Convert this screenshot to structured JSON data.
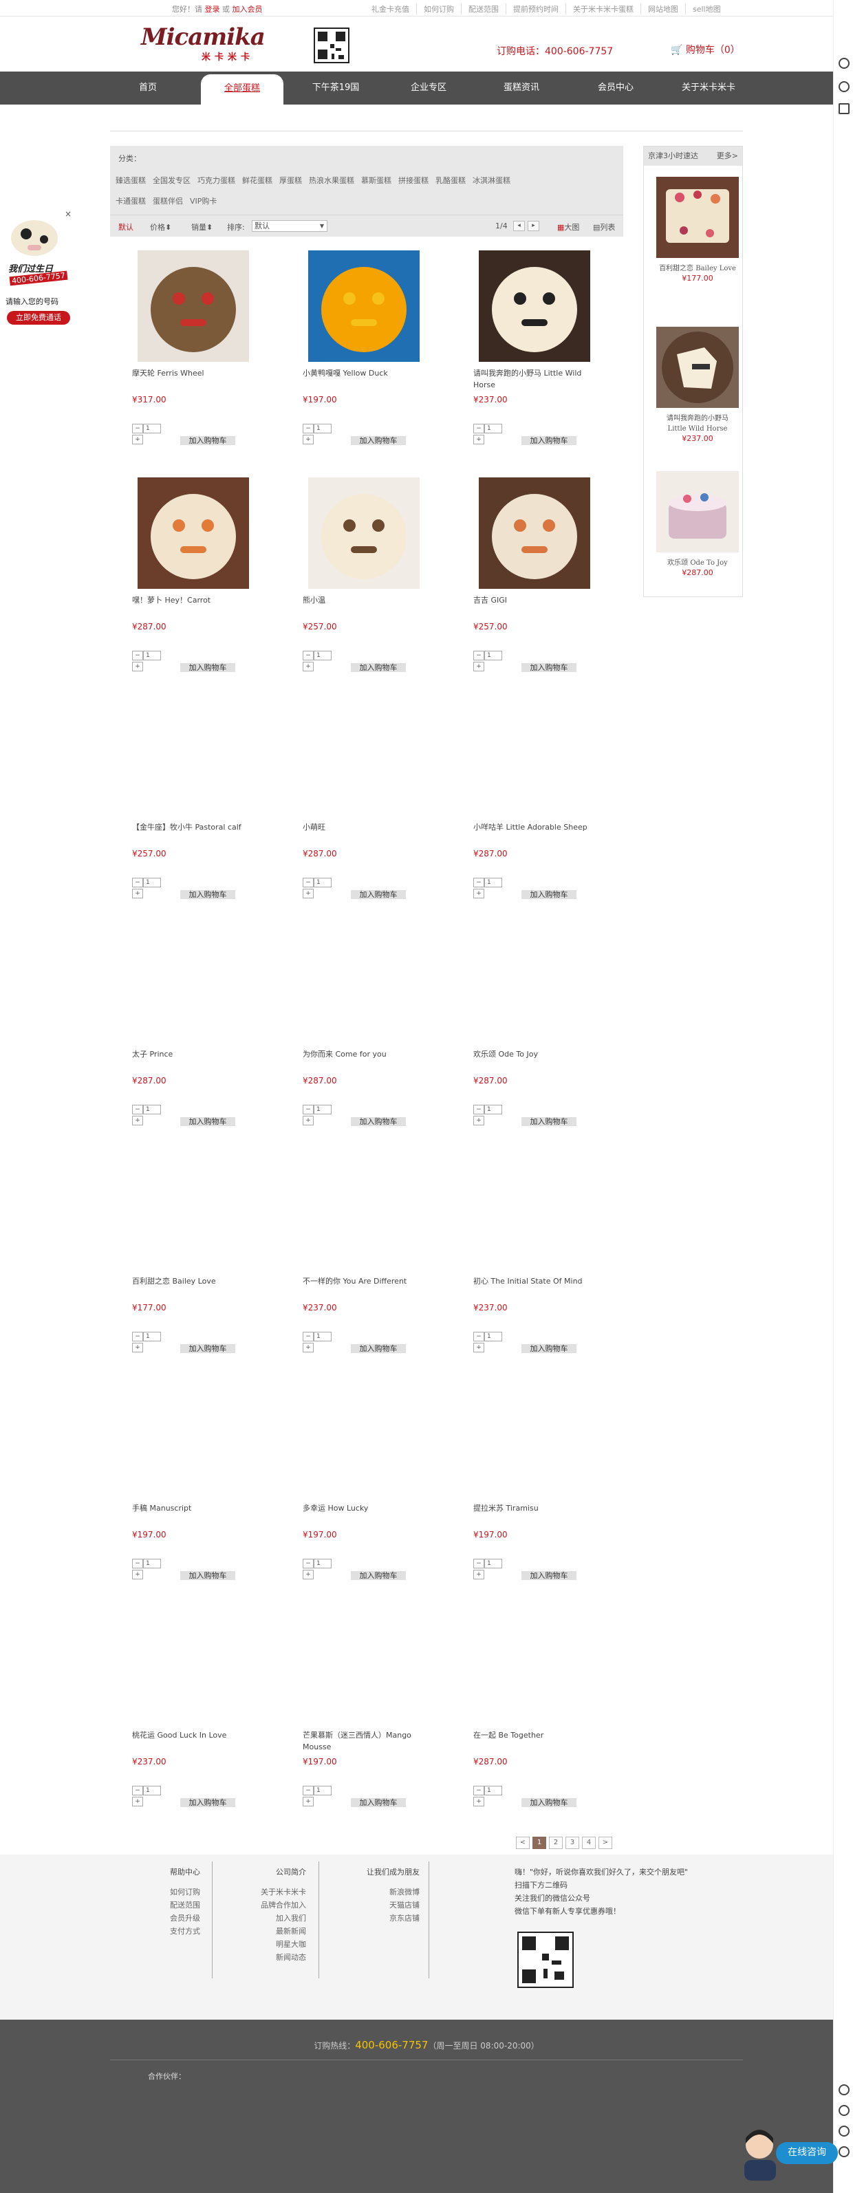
{
  "topbar": {
    "greeting_pre": "您好！请",
    "login": "登录",
    "or": "或",
    "register": "加入会员",
    "links": [
      "礼金卡充值",
      "如何订购",
      "配送范围",
      "提前预约时间",
      "关于米卡米卡蛋糕",
      "网站地图",
      "sell地图"
    ]
  },
  "header": {
    "logo_text": "Micamika",
    "logo_sub": "米卡米卡",
    "phone": "订购电话：400-606-7757",
    "cart": "购物车（0）"
  },
  "nav": [
    "首页",
    "全部蛋糕",
    "下午茶19国",
    "企业专区",
    "蛋糕资讯",
    "会员中心",
    "关于米卡米卡"
  ],
  "filter": {
    "label": "分类：",
    "categories": [
      "臻选蛋糕",
      "全国发专区",
      "巧克力蛋糕",
      "鲜花蛋糕",
      "厚蛋糕",
      "热浪水果蛋糕",
      "慕斯蛋糕",
      "拼接蛋糕",
      "乳酪蛋糕",
      "冰淇淋蛋糕",
      "卡通蛋糕",
      "蛋糕伴侣",
      "VIP购卡"
    ]
  },
  "sort": {
    "default": "默认",
    "price": "价格",
    "sales": "销量",
    "sort_label": "排序:",
    "sort_value": "默认",
    "page": "1/4",
    "view_big": "大图",
    "view_list": "列表"
  },
  "products": [
    {
      "name": "摩天轮 Ferris Wheel",
      "price": "¥317.00"
    },
    {
      "name": "小黄鸭嘎嘎 Yellow Duck",
      "price": "¥197.00"
    },
    {
      "name": "请叫我奔跑的小野马 Little Wild Horse",
      "price": "¥237.00"
    },
    {
      "name": "嘿！萝卜 Hey！Carrot",
      "price": "¥287.00"
    },
    {
      "name": "熊小温",
      "price": "¥257.00"
    },
    {
      "name": "吉吉 GIGI",
      "price": "¥257.00"
    },
    {
      "name": "【金牛座】牧小牛 Pastoral calf",
      "price": "¥257.00"
    },
    {
      "name": "小萌旺",
      "price": "¥287.00"
    },
    {
      "name": "小咩咕羊 Little Adorable Sheep",
      "price": "¥287.00"
    },
    {
      "name": "太子 Prince",
      "price": "¥287.00"
    },
    {
      "name": "为你而来 Come for you",
      "price": "¥287.00"
    },
    {
      "name": "欢乐颂 Ode To Joy",
      "price": "¥287.00"
    },
    {
      "name": "百利甜之恋 Bailey Love",
      "price": "¥177.00"
    },
    {
      "name": "不一样的你 You Are Different",
      "price": "¥237.00"
    },
    {
      "name": "初心 The Initial State Of Mind",
      "price": "¥237.00"
    },
    {
      "name": "手稿 Manuscript",
      "price": "¥197.00"
    },
    {
      "name": "多幸运 How Lucky",
      "price": "¥197.00"
    },
    {
      "name": "提拉米苏 Tiramisu",
      "price": "¥197.00"
    },
    {
      "name": "桃花运 Good Luck In Love",
      "price": "¥237.00"
    },
    {
      "name": "芒果慕斯（迷三西情人）Mango Mousse",
      "price": "¥197.00"
    },
    {
      "name": "在一起 Be Together",
      "price": "¥287.00"
    }
  ],
  "qty_default": "1",
  "add_to_cart": "加入购物车",
  "sidebar": {
    "title": "京津3小时速达",
    "more": "更多>",
    "items": [
      {
        "name": "百利甜之恋 Bailey Love",
        "price": "¥177.00"
      },
      {
        "name": "请叫我奔跑的小野马 Little Wild Horse",
        "price": "¥237.00"
      },
      {
        "name": "欢乐颂 Ode To Joy",
        "price": "¥287.00"
      }
    ]
  },
  "float_ad": {
    "line1": "我们过生日",
    "phone": "400-606-7757",
    "line2": "请输入您的号码",
    "btn": "立即免费通话"
  },
  "pager": [
    "<",
    "1",
    "2",
    "3",
    "4",
    ">"
  ],
  "footer": {
    "col1": {
      "title": "帮助中心",
      "items": [
        "如何订购",
        "配送范围",
        "会员升级",
        "支付方式"
      ]
    },
    "col2": {
      "title": "公司简介",
      "items": [
        "关于米卡米卡",
        "品牌合作加入",
        "加入我们",
        "最新新闻",
        "明星大咖",
        "新闻动态"
      ]
    },
    "col3": {
      "title": "让我们成为朋友",
      "items": [
        "新浪微博",
        "天猫店铺",
        "京东店铺"
      ]
    },
    "message": [
      "嗨！\"你好，听说你喜欢我们好久了，来交个朋友吧\"",
      "扫描下方二维码",
      "关注我们的微信公众号",
      "微信下单有新人专享优惠券哦！"
    ],
    "hotline_label": "订购热线：",
    "hotline": "400-606-7757",
    "hotline_hours": "（周一至周日 08:00-20:00）",
    "partner_label": "合作伙伴："
  },
  "consult": "在线咨询"
}
